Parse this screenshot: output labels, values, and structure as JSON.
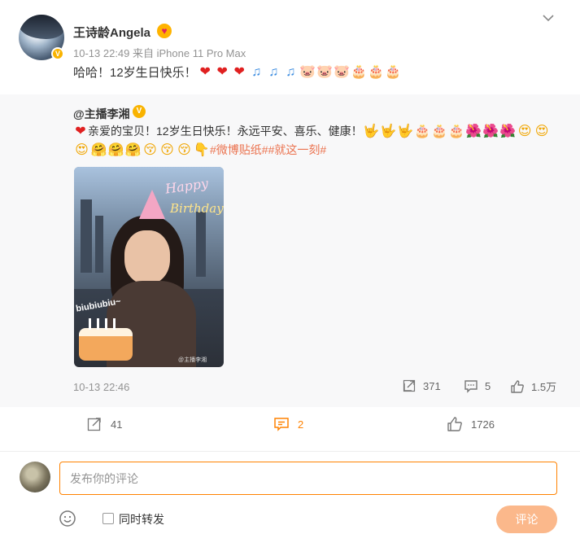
{
  "post": {
    "author": "王诗龄Angela",
    "meta": "10-13 22:49 来自 iPhone 11 Pro Max",
    "text": "哈哈！12岁生日快乐！",
    "emojis": [
      "❤",
      "❤",
      "❤",
      "♫",
      "♫",
      "♫",
      "🐷",
      "🐷",
      "🐷",
      "🎂",
      "🎂",
      "🎂"
    ]
  },
  "repost": {
    "author": "@主播李湘",
    "line1_text": "亲爱的宝贝！12岁生日快乐！永远平安、喜乐、健康！",
    "line1_lead_emoji": "❤",
    "line1_emojis": [
      "🤟",
      "🤟",
      "🤟",
      "🎂",
      "🎂",
      "🎂",
      "🌺",
      "🌺",
      "🌺",
      "😍",
      "😍"
    ],
    "line2_emojis": [
      "😍",
      "🤗",
      "🤗",
      "🤗",
      "😚",
      "😚",
      "😚",
      "👇"
    ],
    "topics": "#微博贴纸##就这一刻#",
    "image": {
      "happy_text": "Happy",
      "birthday_text": "Birthday",
      "sticker_text": "biubiubiu~",
      "watermark": "@主播李湘"
    },
    "time": "10-13 22:46",
    "repost_count": "371",
    "comment_count": "5",
    "like_count": "1.5万"
  },
  "actions": {
    "repost_count": "41",
    "comment_count": "2",
    "like_count": "1726"
  },
  "comment_box": {
    "placeholder": "发布你的评论",
    "also_repost_label": "同时转发",
    "submit_label": "评论"
  },
  "colors": {
    "accent": "#ff8200",
    "topic": "#eb7350",
    "submit_bg": "#fbb88b"
  }
}
